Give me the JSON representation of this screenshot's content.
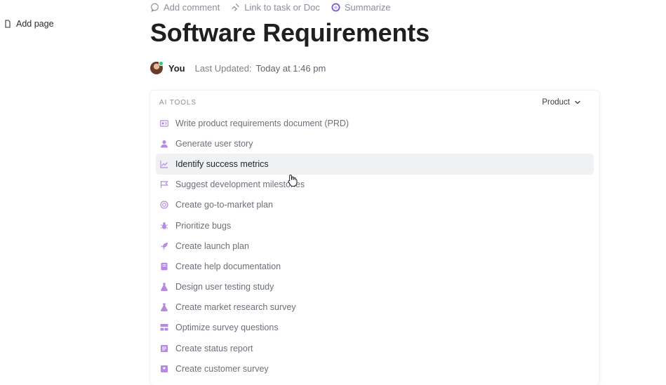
{
  "sidebar": {
    "add_page_label": "Add page",
    "add_page_icon": "page-icon"
  },
  "toolbar": {
    "add_comment": "Add comment",
    "link_task": "Link to task or Doc",
    "summarize": "Summarize"
  },
  "doc": {
    "title": "Software Requirements",
    "author": "You",
    "last_updated_label": "Last Updated:",
    "last_updated_value": "Today at 1:46 pm"
  },
  "ai_tools": {
    "section_label": "AI TOOLS",
    "category": "Product",
    "accent_color": "#b58ae0",
    "active_index": 2,
    "items": [
      {
        "label": "Write product requirements document (PRD)",
        "icon": "document-card-icon"
      },
      {
        "label": "Generate user story",
        "icon": "user-icon"
      },
      {
        "label": "Identify success metrics",
        "icon": "line-chart-icon"
      },
      {
        "label": "Suggest development milestones",
        "icon": "flag-icon"
      },
      {
        "label": "Create go-to-market plan",
        "icon": "target-icon"
      },
      {
        "label": "Prioritize bugs",
        "icon": "bug-icon"
      },
      {
        "label": "Create launch plan",
        "icon": "rocket-icon"
      },
      {
        "label": "Create help documentation",
        "icon": "book-icon"
      },
      {
        "label": "Design user testing study",
        "icon": "flask-icon"
      },
      {
        "label": "Create market research survey",
        "icon": "flask-icon"
      },
      {
        "label": "Optimize survey questions",
        "icon": "cards-icon"
      },
      {
        "label": "Create status report",
        "icon": "report-icon"
      },
      {
        "label": "Create customer survey",
        "icon": "survey-icon"
      }
    ]
  }
}
